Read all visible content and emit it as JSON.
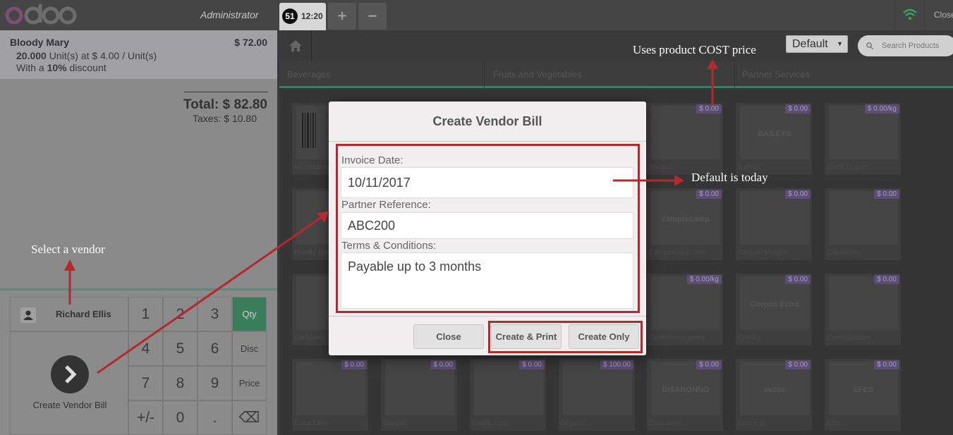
{
  "topbar": {
    "user": "Administrator",
    "order_number": "51",
    "order_time": "12:20",
    "add_label": "+",
    "remove_label": "−",
    "close_label": "Close"
  },
  "order": {
    "line_name": "Bloody Mary",
    "line_price": "$ 72.00",
    "line_qty_strong": "20.000",
    "line_qty_rest": " Unit(s) at $ 4.00 / Unit(s)",
    "line_disc_pre": "With a ",
    "line_disc_strong": "10%",
    "line_disc_post": " discount",
    "total": "Total: $ 82.80",
    "taxes": "Taxes: $ 10.80"
  },
  "pad": {
    "customer": "Richard Ellis",
    "pay_label": "Create Vendor Bill",
    "keys": [
      "1",
      "2",
      "3",
      "4",
      "5",
      "6",
      "7",
      "8",
      "9",
      "+/-",
      "0",
      "."
    ],
    "modes": [
      "Qty",
      "Disc",
      "Price"
    ],
    "backspace": "⌫"
  },
  "search": {
    "placeholder": "Search Products",
    "pricelist": "Default"
  },
  "categories": [
    "Beverages",
    "Fruits and Vegetables",
    "Partner Services"
  ],
  "products": [
    {
      "name": "Miscellaneous",
      "price": ""
    },
    {
      "name": "Bacardi",
      "price": "$ 0.00"
    },
    {
      "name": "Baileys",
      "price": "$ 0.00"
    },
    {
      "name": "Black Grapes",
      "price": "$ 0.00/kg"
    },
    {
      "name": "Bloody Mary",
      "price": ""
    },
    {
      "name": "Camptocamp.com",
      "price": "$ 0.00"
    },
    {
      "name": "Captain Morgan",
      "price": "$ 0.00"
    },
    {
      "name": "Capuccino",
      "price": "$ 0.00"
    },
    {
      "name": "Carlsberg",
      "price": ""
    },
    {
      "name": "Conference pears",
      "price": "$ 0.00/kg"
    },
    {
      "name": "Corona",
      "price": "$ 0.00"
    },
    {
      "name": "Cosmopolitan",
      "price": "$ 0.00"
    },
    {
      "name": "Cuba Libre",
      "price": "$ 0.00"
    },
    {
      "name": "Daiquiri",
      "price": "$ 0.00"
    },
    {
      "name": "Datalp.com",
      "price": "$ 0.00"
    },
    {
      "name": "Deposit",
      "price": "$ 100.00"
    },
    {
      "name": "Disaronno",
      "price": "$ 0.00"
    },
    {
      "name": "Eezee-It",
      "price": "$ 0.00"
    },
    {
      "name": "Efes",
      "price": "$ 0.00"
    }
  ],
  "product_words": {
    "camptocamp": "camptocamp",
    "corona": "Corona Extra",
    "disaronno": "DISARONNO",
    "efes": "EFES",
    "eezee": "eezee",
    "baileys": "BAILEYS"
  },
  "modal": {
    "title": "Create Vendor Bill",
    "invoice_date_label": "Invoice Date:",
    "invoice_date_value": "10/11/2017",
    "partner_ref_label": "Partner Reference:",
    "partner_ref_value": "ABC200",
    "terms_label": "Terms & Conditions:",
    "terms_value": "Payable up to 3 months",
    "close_btn": "Close",
    "create_print_btn": "Create & Print",
    "create_only_btn": "Create Only"
  },
  "annotations": {
    "cost": "Uses product COST price",
    "today": "Default is today",
    "vendor": "Select a vendor"
  },
  "colors": {
    "annotation_red": "#b5282e",
    "accent_green": "#3a7d5a",
    "price_tag": "#5b4d73"
  }
}
